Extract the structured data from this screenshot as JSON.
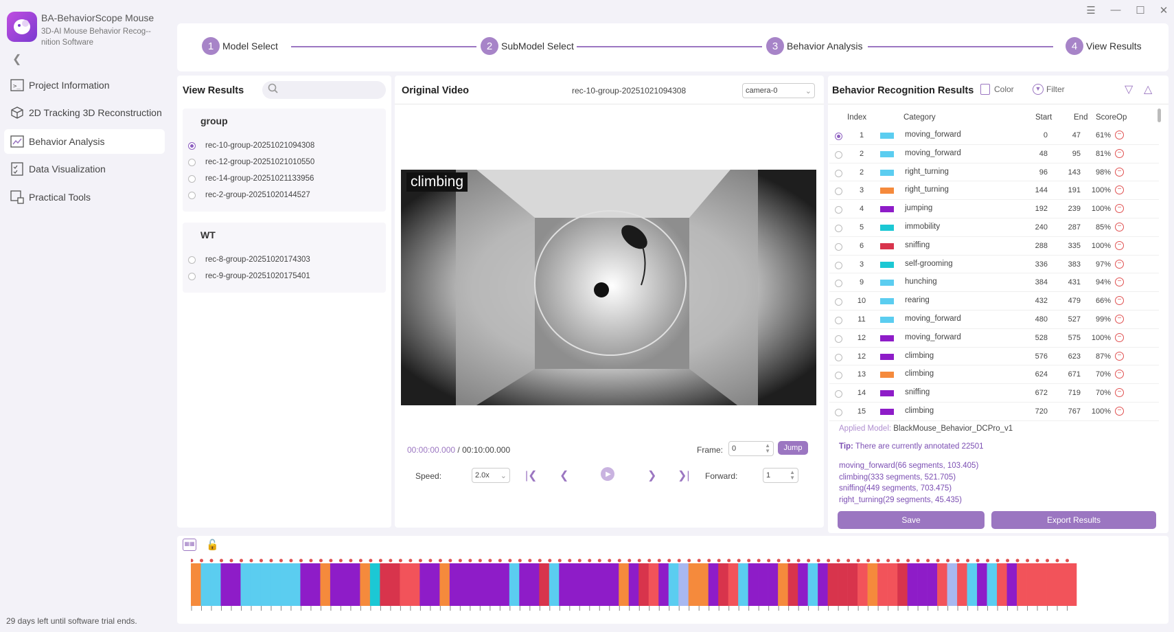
{
  "app": {
    "title": "BA-BehaviorScope Mouse",
    "subtitle": "3D-AI Mouse Behavior Recog-­nition Software"
  },
  "sidebar": {
    "items": [
      {
        "label": "Project Information",
        "icon": "terminal-icon"
      },
      {
        "label": "2D Tracking 3D Reconstruction",
        "icon": "cube-icon"
      },
      {
        "label": "Behavior Analysis",
        "icon": "chart-icon"
      },
      {
        "label": "Data Visualization",
        "icon": "checklist-icon"
      },
      {
        "label": "Practical Tools",
        "icon": "tools-icon"
      }
    ],
    "active_index": 2,
    "trial_text": "29 days left until software trial ends."
  },
  "stepper": [
    {
      "num": "1",
      "label": "Model Select"
    },
    {
      "num": "2",
      "label": "SubModel Select"
    },
    {
      "num": "3",
      "label": "Behavior Analysis"
    },
    {
      "num": "4",
      "label": "View Results"
    }
  ],
  "results_panel": {
    "title": "View Results",
    "groups": [
      {
        "name": "group",
        "recs": [
          "rec-10-group-20251021094308",
          "rec-12-group-20251021010550",
          "rec-14-group-20251021133956",
          "rec-2-group-20251020144527"
        ]
      },
      {
        "name": "WT",
        "recs": [
          "rec-8-group-20251020174303",
          "rec-9-group-20251020175401"
        ]
      }
    ],
    "selected": "rec-10-group-20251021094308"
  },
  "video_panel": {
    "title": "Original Video",
    "file": "rec-10-group-20251021094308",
    "camera": "camera-0",
    "overlay_label": "climbing",
    "time_current": "00:00:00.000",
    "time_total": "/ 00:10:00.000",
    "frame_label": "Frame:",
    "frame_value": "0",
    "jump_label": "Jump",
    "speed_label": "Speed:",
    "speed_value": "2.0x",
    "forward_label": "Forward:",
    "forward_value": "1"
  },
  "recognition": {
    "title": "Behavior Recognition Results",
    "color_label": "Color",
    "filter_label": "Filter",
    "columns": [
      "Index",
      "Category",
      "Start",
      "End",
      "Score",
      "Op"
    ],
    "rows": [
      {
        "index": "1",
        "color": "#5bcdf0",
        "category": "moving_forward",
        "start": "0",
        "end": "47",
        "score": "61%"
      },
      {
        "index": "2",
        "color": "#5bcdf0",
        "category": "moving_forward",
        "start": "48",
        "end": "95",
        "score": "81%"
      },
      {
        "index": "2",
        "color": "#5bcdf0",
        "category": "right_turning",
        "start": "96",
        "end": "143",
        "score": "98%"
      },
      {
        "index": "3",
        "color": "#f58a3c",
        "category": "right_turning",
        "start": "144",
        "end": "191",
        "score": "100%"
      },
      {
        "index": "4",
        "color": "#8e1cc8",
        "category": "jumping",
        "start": "192",
        "end": "239",
        "score": "100%"
      },
      {
        "index": "5",
        "color": "#1cc8d4",
        "category": "immobility",
        "start": "240",
        "end": "287",
        "score": "85%"
      },
      {
        "index": "6",
        "color": "#d8344c",
        "category": "sniffing",
        "start": "288",
        "end": "335",
        "score": "100%"
      },
      {
        "index": "3",
        "color": "#1cc8d4",
        "category": "self-grooming",
        "start": "336",
        "end": "383",
        "score": "97%"
      },
      {
        "index": "9",
        "color": "#5bcdf0",
        "category": "hunching",
        "start": "384",
        "end": "431",
        "score": "94%"
      },
      {
        "index": "10",
        "color": "#5bcdf0",
        "category": "rearing",
        "start": "432",
        "end": "479",
        "score": "66%"
      },
      {
        "index": "11",
        "color": "#5bcdf0",
        "category": "moving_forward",
        "start": "480",
        "end": "527",
        "score": "99%"
      },
      {
        "index": "12",
        "color": "#8e1cc8",
        "category": "moving_forward",
        "start": "528",
        "end": "575",
        "score": "100%"
      },
      {
        "index": "12",
        "color": "#8e1cc8",
        "category": "climbing",
        "start": "576",
        "end": "623",
        "score": "87%"
      },
      {
        "index": "13",
        "color": "#f58a3c",
        "category": "climbing",
        "start": "624",
        "end": "671",
        "score": "70%"
      },
      {
        "index": "14",
        "color": "#8e1cc8",
        "category": "sniffing",
        "start": "672",
        "end": "719",
        "score": "70%"
      },
      {
        "index": "15",
        "color": "#8e1cc8",
        "category": "climbing",
        "start": "720",
        "end": "767",
        "score": "100%"
      }
    ],
    "applied_model_label": "Applied Model:",
    "applied_model": "BlackMouse_Behavior_DCPro_v1",
    "tip_label": "Tip:",
    "tip_text": "There are currently annotated 22501",
    "summary": [
      "moving_forward(66 segments, 103.405)",
      "climbing(333 segments, 521.705)",
      "sniffing(449 segments, 703.475)",
      "right_turning(29 segments, 45.435)"
    ],
    "save_label": "Save",
    "export_label": "Export Results"
  },
  "timeline": {
    "colors": [
      "#f58a3c",
      "#5bcdf0",
      "#5bcdf0",
      "#8e1cc8",
      "#8e1cc8",
      "#5bcdf0",
      "#5bcdf0",
      "#5bcdf0",
      "#5bcdf0",
      "#5bcdf0",
      "#5bcdf0",
      "#8e1cc8",
      "#8e1cc8",
      "#f58a3c",
      "#8e1cc8",
      "#8e1cc8",
      "#8e1cc8",
      "#f58a3c",
      "#1cc8d4",
      "#d8344c",
      "#d8344c",
      "#f2535a",
      "#f2535a",
      "#8e1cc8",
      "#8e1cc8",
      "#f58a3c",
      "#8e1cc8",
      "#8e1cc8",
      "#8e1cc8",
      "#8e1cc8",
      "#8e1cc8",
      "#8e1cc8",
      "#5bcdf0",
      "#8e1cc8",
      "#8e1cc8",
      "#d8344c",
      "#5bcdf0",
      "#8e1cc8",
      "#8e1cc8",
      "#8e1cc8",
      "#8e1cc8",
      "#8e1cc8",
      "#8e1cc8",
      "#f58a3c",
      "#8e1cc8",
      "#d8344c",
      "#f2535a",
      "#8e1cc8",
      "#5bcdf0",
      "#a8b8f0",
      "#f58a3c",
      "#f58a3c",
      "#8e1cc8",
      "#d8344c",
      "#f2535a",
      "#5bcdf0",
      "#8e1cc8",
      "#8e1cc8",
      "#8e1cc8",
      "#f58a3c",
      "#d8344c",
      "#8e1cc8",
      "#5bcdf0",
      "#8e1cc8",
      "#d8344c",
      "#d8344c",
      "#d8344c",
      "#f2535a",
      "#f58a3c",
      "#f2535a",
      "#f2535a",
      "#d8344c",
      "#8e1cc8",
      "#8e1cc8",
      "#8e1cc8",
      "#f2535a",
      "#a8b8f0",
      "#f2535a",
      "#5bcdf0",
      "#8e1cc8",
      "#5bcdf0",
      "#f2535a",
      "#8e1cc8",
      "#f2535a",
      "#f2535a",
      "#f2535a",
      "#f2535a",
      "#f2535a",
      "#f2535a"
    ]
  },
  "accent_color": "#9b76c1"
}
